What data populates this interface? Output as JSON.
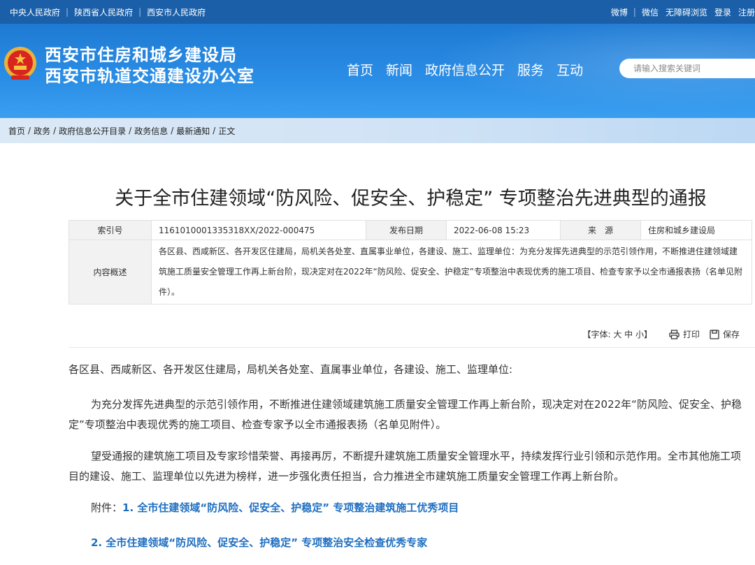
{
  "topbar": {
    "left_links": [
      "中央人民政府",
      "陕西省人民政府",
      "西安市人民政府"
    ],
    "right_links": [
      "微博",
      "微信",
      "无障碍浏览",
      "登录",
      "注册"
    ]
  },
  "header": {
    "org_line1": "西安市住房和城乡建设局",
    "org_line2": "西安市轨道交通建设办公室",
    "nav": [
      "首页",
      "新闻",
      "政府信息公开",
      "服务",
      "互动"
    ],
    "search_placeholder": "请输入搜索关键词"
  },
  "breadcrumb": [
    "首页",
    "政务",
    "政府信息公开目录",
    "政务信息",
    "最新通知",
    "正文"
  ],
  "article": {
    "title": "关于全市住建领域“防风险、促安全、护稳定” 专项整治先进典型的通报",
    "meta": {
      "index_label": "索引号",
      "index_value": "1161010001335318XX/2022-000475",
      "date_label": "发布日期",
      "date_value": "2022-06-08 15:23",
      "source_label": "来　源",
      "source_value": "住房和城乡建设局",
      "summary_label": "内容概述",
      "summary_value": "各区县、西咸新区、各开发区住建局，局机关各处室、直属事业单位，各建设、施工、监理单位：为充分发挥先进典型的示范引领作用，不断推进住建领域建筑施工质量安全管理工作再上新台阶，现决定对在2022年“防风险、促安全、护稳定”专项整治中表现优秀的施工项目、检查专家予以全市通报表扬（名单见附件）。"
    },
    "tools": {
      "font_label": "【字体: 大 中 小】",
      "print_label": "打印",
      "save_label": "保存"
    },
    "paragraphs": {
      "p1": "各区县、西咸新区、各开发区住建局，局机关各处室、直属事业单位，各建设、施工、监理单位:",
      "p2": "为充分发挥先进典型的示范引领作用，不断推进住建领域建筑施工质量安全管理工作再上新台阶，现决定对在2022年“防风险、促安全、护稳定”专项整治中表现优秀的施工项目、检查专家予以全市通报表扬（名单见附件）。",
      "p3": "望受通报的建筑施工项目及专家珍惜荣誉、再接再厉，不断提升建筑施工质量安全管理水平，持续发挥行业引领和示范作用。全市其他施工项目的建设、施工、监理单位以先进为榜样，进一步强化责任担当，合力推进全市建筑施工质量安全管理工作再上新台阶。"
    },
    "attachments": {
      "label": "附件：",
      "items": [
        "1. 全市住建领域“防风险、促安全、护稳定” 专项整治建筑施工优秀项目",
        "2. 全市住建领域“防风险、促安全、护稳定” 专项整治安全检查优秀专家"
      ]
    }
  },
  "colors": {
    "topbar": "#1a5fa8",
    "header": "#2b8ee6",
    "link": "#1f6fc1"
  }
}
